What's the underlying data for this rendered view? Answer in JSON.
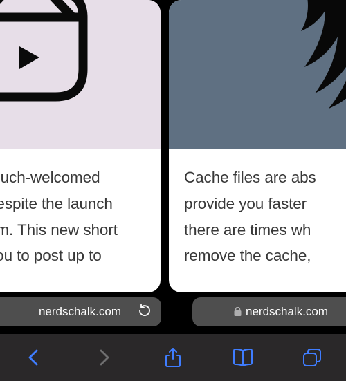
{
  "tabs": {
    "left": {
      "hero_bg": "#e7dee8",
      "icon": "box-icon",
      "body": " much-welcomed\n despite the launch\nem. This new short\n you to post up to",
      "url": "nerdschalk.com"
    },
    "right": {
      "hero_bg": "#5f7082",
      "icon": "software-icon",
      "body": "Cache files are abs\nprovide you faster \nthere are times wh\nremove the cache,",
      "url": "nerdschalk.com"
    }
  },
  "toolbar": {
    "back": "back-icon",
    "forward": "forward-icon",
    "share": "share-icon",
    "forward_enabled": false,
    "bookmarks": "bookmarks-icon",
    "tabs": "tabs-icon"
  },
  "colors": {
    "accent": "#3f7dff",
    "disabled": "#6f6f70",
    "addr_bg": "#4e4e4e",
    "toolbar_bg": "#2a2829"
  }
}
